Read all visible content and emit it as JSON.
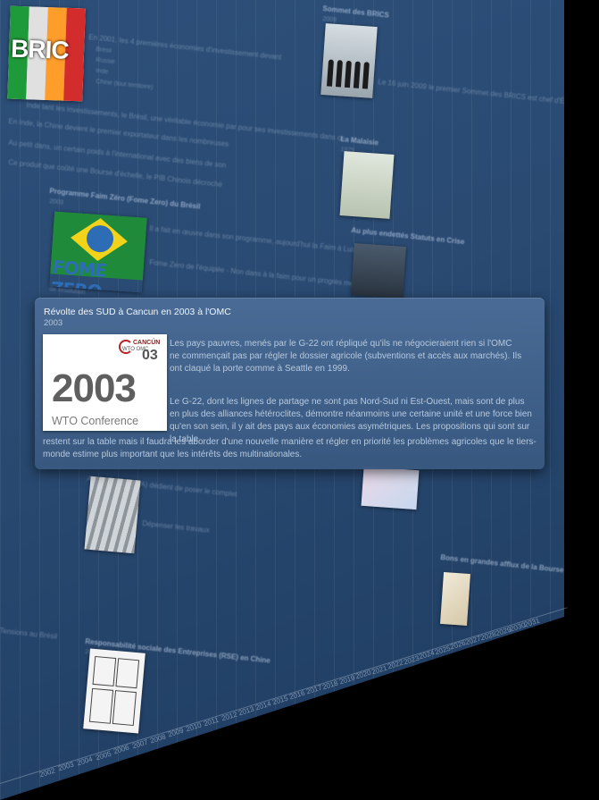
{
  "popup": {
    "title": "Révolte des SUD à Cancun en 2003 à l'OMC",
    "date": "2003",
    "image": {
      "year_text": "2003",
      "caption": "WTO Conference",
      "logo_line1": "CANCÚN",
      "logo_line2": "WTO OMC",
      "logo_year": "03"
    },
    "paragraph1": "Les pays pauvres, menés par le G-22 ont répliqué qu'ils ne négocieraient rien si l'OMC ne commençait pas par régler le dossier agricole (subventions et accès aux marchés). Ils ont claqué la porte comme à Seattle en 1999.",
    "paragraph2_a": "Le G-22, dont les lignes de partage ne sont pas Nord-Sud ni Est-Ouest, mais sont de plus en plus des alliances hétéroclites, démontre néanmoins une certaine unité et une force bien qu'en son sein, il y ait des pays aux économies asymétriques. Les propositions qui sont sur la table",
    "paragraph2_b": "restent sur la table mais il faudra les aborder d'une nouvelle manière et régler en priorité les problèmes agricoles que le tiers-monde estime plus important que les intérêts des multinationales."
  },
  "background": {
    "bric_label": "BRIC",
    "fome_label": "FOME ZERO",
    "faint_texts": [
      "En 2001, les 4 premières économies d'investissement devant",
      "Brésil",
      "Russie",
      "Inde",
      "Chine (tout territoire)",
      "Inde tant les investissements, le Brésil, une véritable économie par pour ses investissements dans ce",
      "En Inde, la Chine devient le premier exportateur dans les nombreuses",
      "Au petit dans, un certain poids à l'international avec des biens de son",
      "Ce produit que coûté une Bourse d'échelle, le PIB Chinois décroché",
      "Programme Faim Zéro (Fome Zero) du Brésil",
      "2003",
      "Il a fait en œuvre dans son programme, aujourd'hui la Faim à Lula",
      "Fome Zero de l'équipée - Non dans à la faim pour un progrès mesure",
      "de résolution",
      "Sommet des BRICS",
      "2009",
      "Le 16 juin 2009 le premier Sommet des BRICS est chef d'État",
      "La Malaisie",
      "1975",
      "Au plus endettés Statuts en Crise",
      "ArcelorMittal (OPA) dédient de poser le complet",
      "Dépenser les travaux",
      "Responsabilité sociale des Entreprises (RSE) en Chine",
      "2008",
      "Bons en grandes afflux de la Bourse",
      "Tensions au Brésil"
    ],
    "years": [
      "2002",
      "2003",
      "2004",
      "2005",
      "2006",
      "2007",
      "2008",
      "2009",
      "2010",
      "2011",
      "2012",
      "2013",
      "2014",
      "2015",
      "2016",
      "2017",
      "2018",
      "2019",
      "2020",
      "2021",
      "2022",
      "2023",
      "2024",
      "2025",
      "2026",
      "2027",
      "2028",
      "2029",
      "2030",
      "2031"
    ]
  }
}
